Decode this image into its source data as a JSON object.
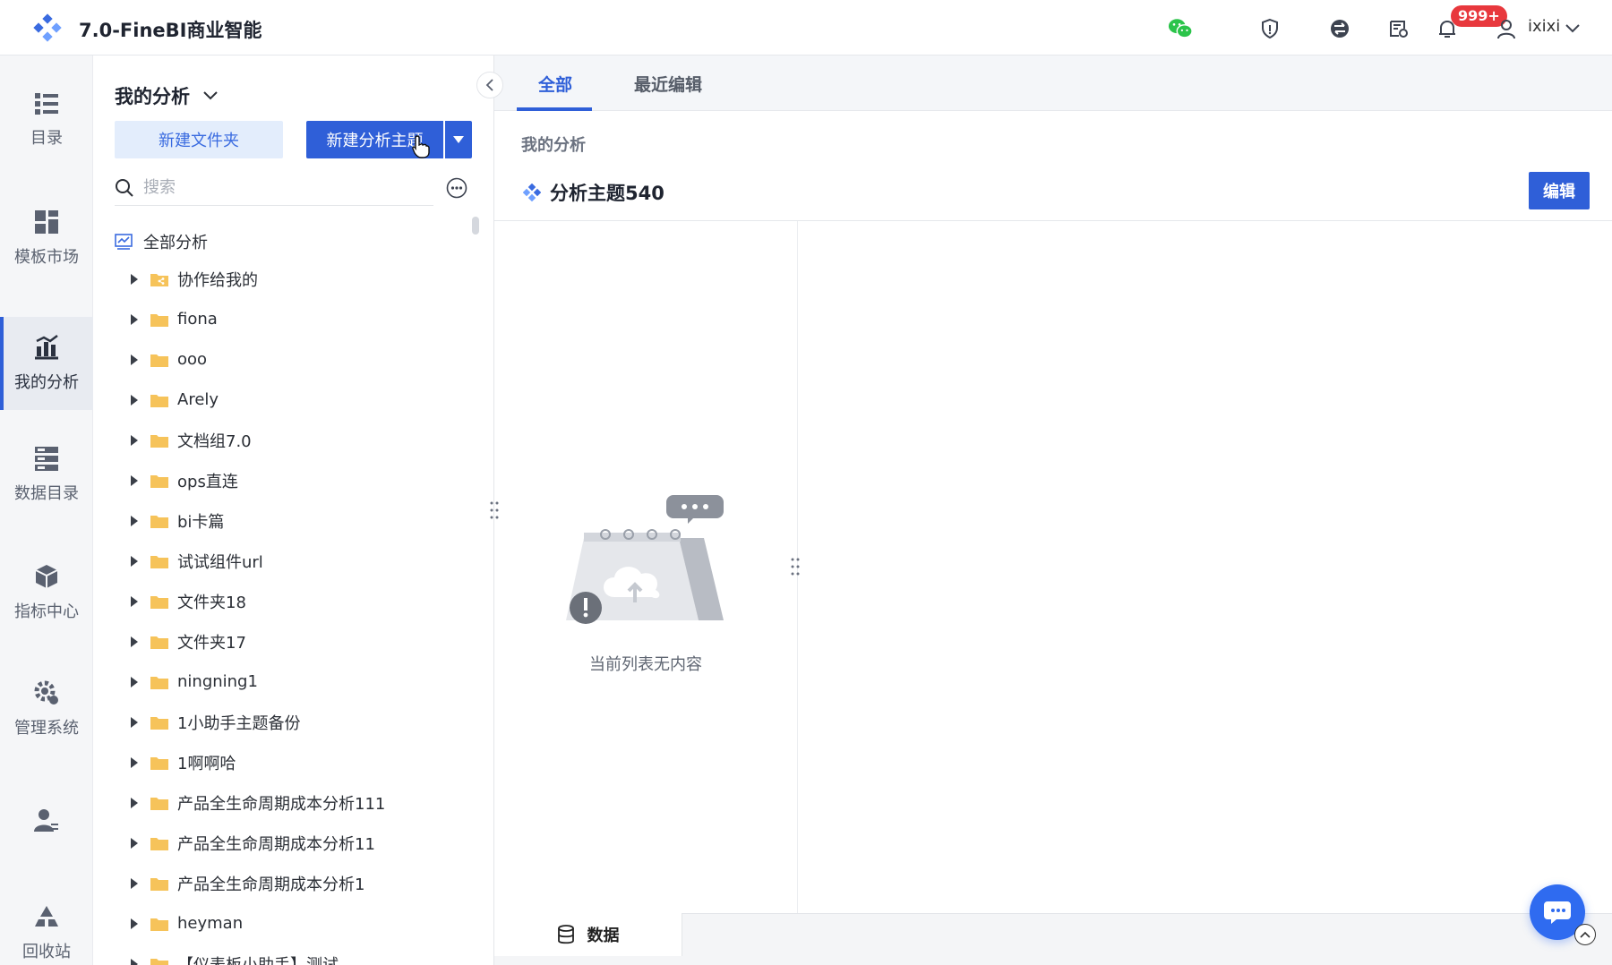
{
  "app": {
    "title": "7.0-FineBI商业智能"
  },
  "header": {
    "notification_count": "999+",
    "user_name": "ixixi"
  },
  "nav": {
    "items": [
      {
        "label": "目录",
        "icon": "catalog-icon"
      },
      {
        "label": "模板市场",
        "icon": "template-market-icon"
      },
      {
        "label": "我的分析",
        "icon": "my-analysis-icon",
        "active": true
      },
      {
        "label": "数据目录",
        "icon": "data-catalog-icon"
      },
      {
        "label": "指标中心",
        "icon": "metrics-center-icon"
      },
      {
        "label": "管理系统",
        "icon": "admin-system-icon"
      },
      {
        "label": "",
        "icon": "user-management-icon"
      },
      {
        "label": "回收站",
        "icon": "recycle-bin-icon"
      }
    ]
  },
  "explorer": {
    "title": "我的分析",
    "new_folder_label": "新建文件夹",
    "new_topic_label": "新建分析主题",
    "search_placeholder": "搜索",
    "root_label": "全部分析",
    "items": [
      {
        "label": "协作给我的",
        "shared": true
      },
      {
        "label": "fiona"
      },
      {
        "label": "ooo"
      },
      {
        "label": "Arely"
      },
      {
        "label": "文档组7.0"
      },
      {
        "label": "ops直连"
      },
      {
        "label": "bi卡篇"
      },
      {
        "label": "试试组件url"
      },
      {
        "label": "文件夹18"
      },
      {
        "label": "文件夹17"
      },
      {
        "label": "ningning1"
      },
      {
        "label": "1小助手主题备份"
      },
      {
        "label": "1啊啊哈"
      },
      {
        "label": "产品全生命周期成本分析111"
      },
      {
        "label": "产品全生命周期成本分析11"
      },
      {
        "label": "产品全生命周期成本分析1"
      },
      {
        "label": "heyman"
      },
      {
        "label": "【仪表板小助手】测试"
      }
    ]
  },
  "content": {
    "tabs": [
      {
        "label": "全部",
        "active": true
      },
      {
        "label": "最近编辑"
      }
    ],
    "breadcrumb": "我的分析",
    "topic_title": "分析主题540",
    "edit_label": "编辑",
    "empty_text": "当前列表无内容",
    "data_tab_label": "数据"
  },
  "colors": {
    "accent": "#2f5fd8",
    "folder": "#f6c35a",
    "badge": "#e8383d",
    "wechat": "#2bc44a"
  }
}
